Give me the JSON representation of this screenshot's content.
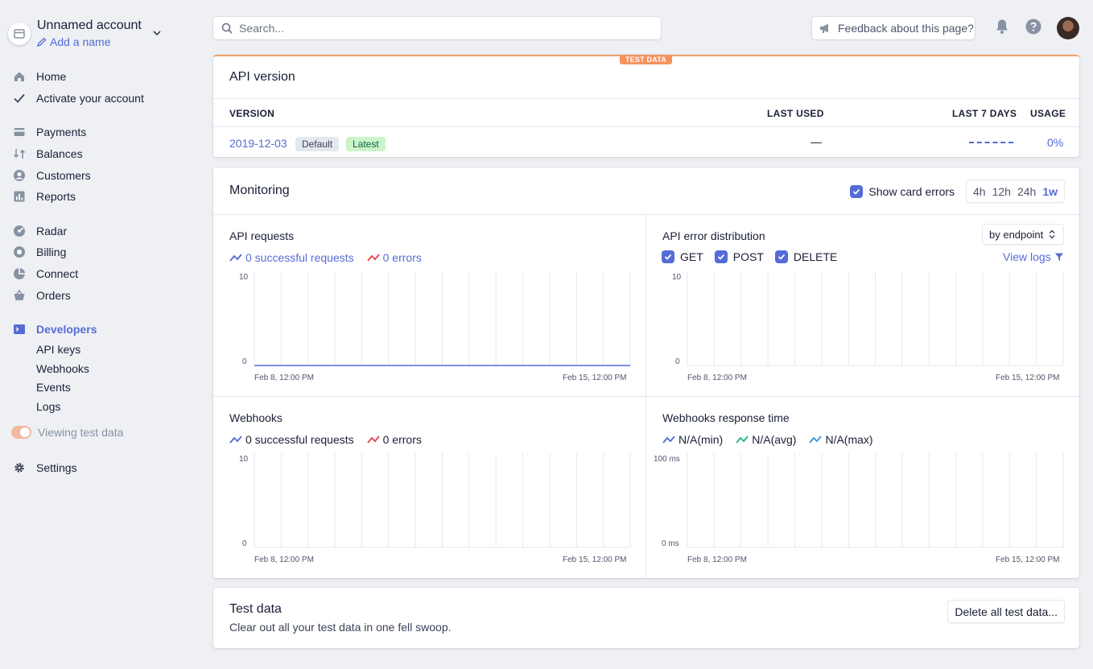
{
  "account": {
    "name": "Unnamed account",
    "add_name": "Add a name"
  },
  "nav": {
    "home": "Home",
    "activate": "Activate your account",
    "payments": "Payments",
    "balances": "Balances",
    "customers": "Customers",
    "reports": "Reports",
    "radar": "Radar",
    "billing": "Billing",
    "connect": "Connect",
    "orders": "Orders",
    "developers": "Developers",
    "dev_sub": [
      "API keys",
      "Webhooks",
      "Events",
      "Logs"
    ],
    "viewing_test": "Viewing test data",
    "settings": "Settings"
  },
  "topbar": {
    "search_placeholder": "Search...",
    "feedback": "Feedback about this page?"
  },
  "api_version": {
    "badge": "TEST DATA",
    "title": "API version",
    "headers": {
      "version": "VERSION",
      "last_used": "LAST USED",
      "last7": "LAST 7 DAYS",
      "usage": "USAGE"
    },
    "row": {
      "version": "2019-12-03",
      "default": "Default",
      "latest": "Latest",
      "last_used": "—",
      "usage": "0%"
    }
  },
  "monitoring": {
    "title": "Monitoring",
    "show_errors": "Show card errors",
    "ranges": [
      "4h",
      "12h",
      "24h",
      "1w"
    ],
    "selected_range": "1w",
    "api_requests": {
      "title": "API requests",
      "success": "0 successful requests",
      "errors": "0 errors",
      "y_top": "10",
      "y_bottom": "0",
      "x_start": "Feb 8, 12:00 PM",
      "x_end": "Feb 15, 12:00 PM"
    },
    "error_dist": {
      "title": "API error distribution",
      "select": "by endpoint",
      "methods": [
        "GET",
        "POST",
        "DELETE"
      ],
      "view_logs": "View logs",
      "y_top": "10",
      "y_bottom": "0",
      "x_start": "Feb 8, 12:00 PM",
      "x_end": "Feb 15, 12:00 PM"
    },
    "webhooks": {
      "title": "Webhooks",
      "success": "0 successful requests",
      "errors": "0 errors",
      "y_top": "10",
      "y_bottom": "0",
      "x_start": "Feb 8, 12:00 PM",
      "x_end": "Feb 15, 12:00 PM"
    },
    "response_time": {
      "title": "Webhooks response time",
      "min": "N/A(min)",
      "avg": "N/A(avg)",
      "max": "N/A(max)",
      "y_top": "100 ms",
      "y_bottom": "0 ms",
      "x_start": "Feb 8, 12:00 PM",
      "x_end": "Feb 15, 12:00 PM"
    }
  },
  "test_data": {
    "title": "Test data",
    "desc": "Clear out all your test data in one fell swoop.",
    "button": "Delete all test data..."
  },
  "colors": {
    "accent": "#556cd6",
    "error": "#e5424d",
    "success": "#24b47e",
    "test_orange": "#f5925e"
  }
}
